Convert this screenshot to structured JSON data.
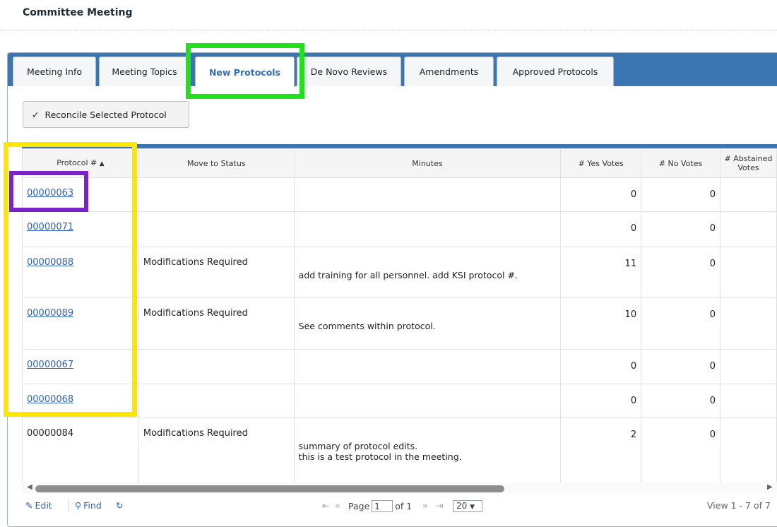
{
  "page": {
    "title": "Committee Meeting"
  },
  "tabs": [
    {
      "label": "Meeting Info"
    },
    {
      "label": "Meeting Topics"
    },
    {
      "label": "New Protocols"
    },
    {
      "label": "De Novo Reviews"
    },
    {
      "label": "Amendments"
    },
    {
      "label": "Approved Protocols"
    }
  ],
  "toolbar": {
    "reconcile_label": "Reconcile Selected Protocol",
    "check_icon": "✓"
  },
  "grid": {
    "columns": {
      "protocol": "Protocol #",
      "status": "Move to Status",
      "minutes": "Minutes",
      "yes": "# Yes Votes",
      "no": "# No Votes",
      "abstained_1": "# Abstained",
      "abstained_2": "Votes"
    },
    "rows": [
      {
        "protocol": "00000063",
        "status": "",
        "minutes_1": "",
        "minutes_2": "",
        "yes": "0",
        "no": "0"
      },
      {
        "protocol": "00000071",
        "status": "",
        "minutes_1": "",
        "minutes_2": "",
        "yes": "0",
        "no": "0"
      },
      {
        "protocol": "00000088",
        "status": "Modifications Required",
        "minutes_1": "add training for all personnel. add KSI protocol #.",
        "minutes_2": "",
        "yes": "11",
        "no": "0"
      },
      {
        "protocol": "00000089",
        "status": "Modifications Required",
        "minutes_1": "See comments within protocol.",
        "minutes_2": "",
        "yes": "10",
        "no": "0"
      },
      {
        "protocol": "00000067",
        "status": "",
        "minutes_1": "",
        "minutes_2": "",
        "yes": "0",
        "no": "0"
      },
      {
        "protocol": "00000068",
        "status": "",
        "minutes_1": "",
        "minutes_2": "",
        "yes": "0",
        "no": "0"
      },
      {
        "protocol": "00000084",
        "status": "Modifications Required",
        "minutes_1": "summary of protocol edits.",
        "minutes_2": "this is a test protocol in the meeting.",
        "yes": "2",
        "no": "0"
      }
    ]
  },
  "pager": {
    "edit": "Edit",
    "find": "Find",
    "page_label": "Page",
    "page_value": "1",
    "of_label": "of 1",
    "page_size": "20",
    "view_info": "View 1 - 7 of 7"
  },
  "highlights": {
    "green": "#22e01c",
    "yellow": "#ffe600",
    "purple": "#7b22c9"
  }
}
